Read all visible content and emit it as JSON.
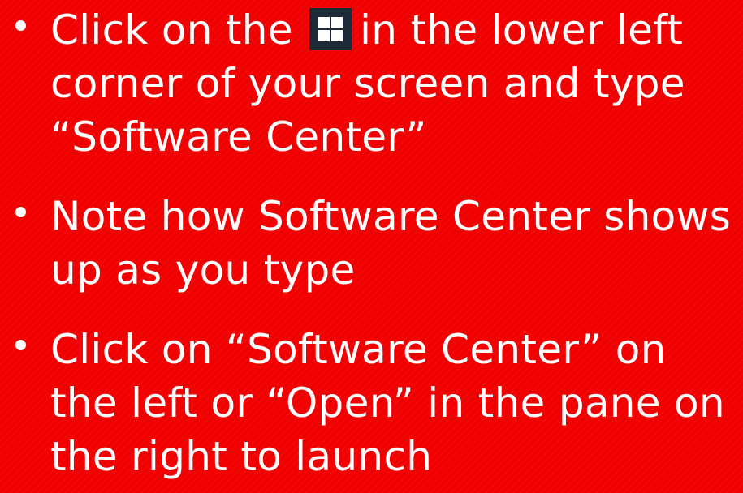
{
  "slide": {
    "background_color": "#f10000",
    "text_color": "#ffffff",
    "bullets": [
      {
        "line1_before_icon": "Click on the",
        "icon": "windows-logo-icon",
        "line1_after_icon": "in the lower left",
        "line2": "corner of your screen and type",
        "line3": "“Software Center”"
      },
      {
        "line1": "Note how Software Center shows",
        "line2": "up as you type"
      },
      {
        "line1": "Click on “Software Center” on",
        "line2": "the left or “Open” in the pane on",
        "line3": "the right to launch"
      }
    ]
  }
}
